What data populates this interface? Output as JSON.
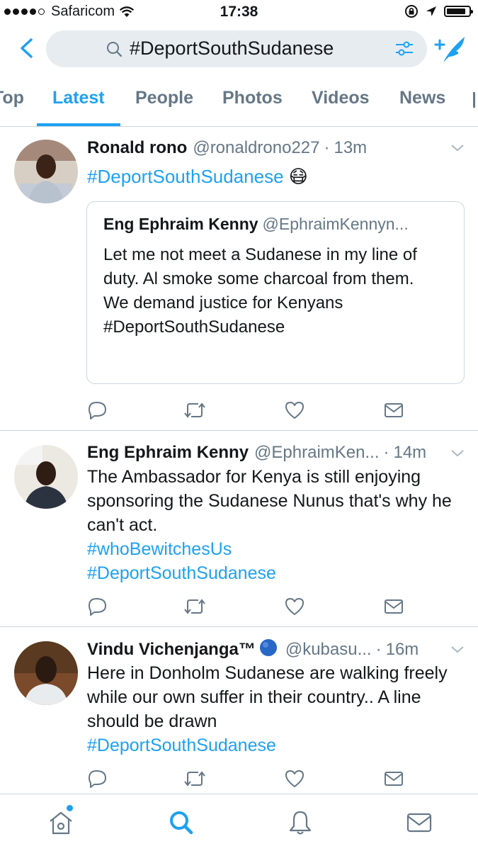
{
  "status_bar": {
    "carrier": "Safaricom",
    "time": "17:38",
    "battery_level": 0.85
  },
  "search": {
    "query": "#DeportSouthSudanese"
  },
  "tabs": [
    {
      "label": "Top",
      "active": false
    },
    {
      "label": "Latest",
      "active": true
    },
    {
      "label": "People",
      "active": false
    },
    {
      "label": "Photos",
      "active": false
    },
    {
      "label": "Videos",
      "active": false
    },
    {
      "label": "News",
      "active": false
    }
  ],
  "tweets": [
    {
      "name": "Ronald rono",
      "handle": "@ronaldrono227",
      "separator": "·",
      "time": "13m",
      "text_hashtag": "#DeportSouthSudanese",
      "emoji": "😷",
      "quote": {
        "name": "Eng Ephraim Kenny",
        "handle": "@EphraimKennyn...",
        "line1": "Let me not meet a Sudanese in my line of duty. Al smoke some charcoal from them.",
        "line2": "We demand justice for Kenyans",
        "hashtag": "#DeportSouthSudanese"
      }
    },
    {
      "name": "Eng Ephraim Kenny",
      "handle": "@EphraimKen...",
      "separator": "·",
      "time": "14m",
      "text": "The Ambassador for Kenya is still enjoying sponsoring the Sudanese Nunus that's why he can't act.",
      "hashtag1": "#whoBewitchesUs",
      "hashtag2": "#DeportSouthSudanese"
    },
    {
      "name": "Vindu Vichenjanga™",
      "handle": "@kubasu...",
      "separator": "·",
      "time": "16m",
      "text": "Here in Donholm Sudanese are walking freely while our own suffer in their country.. A line should be drawn",
      "hashtag": "#DeportSouthSudanese"
    }
  ],
  "colors": {
    "accent": "#1da1f2",
    "text": "#14171a",
    "secondary": "#657786",
    "border": "#ccd6dd"
  },
  "icons": {
    "actions": [
      "reply-icon",
      "retweet-icon",
      "like-icon",
      "dm-icon"
    ],
    "bottom_nav": [
      "home-icon",
      "search-icon",
      "notifications-icon",
      "messages-icon"
    ]
  }
}
